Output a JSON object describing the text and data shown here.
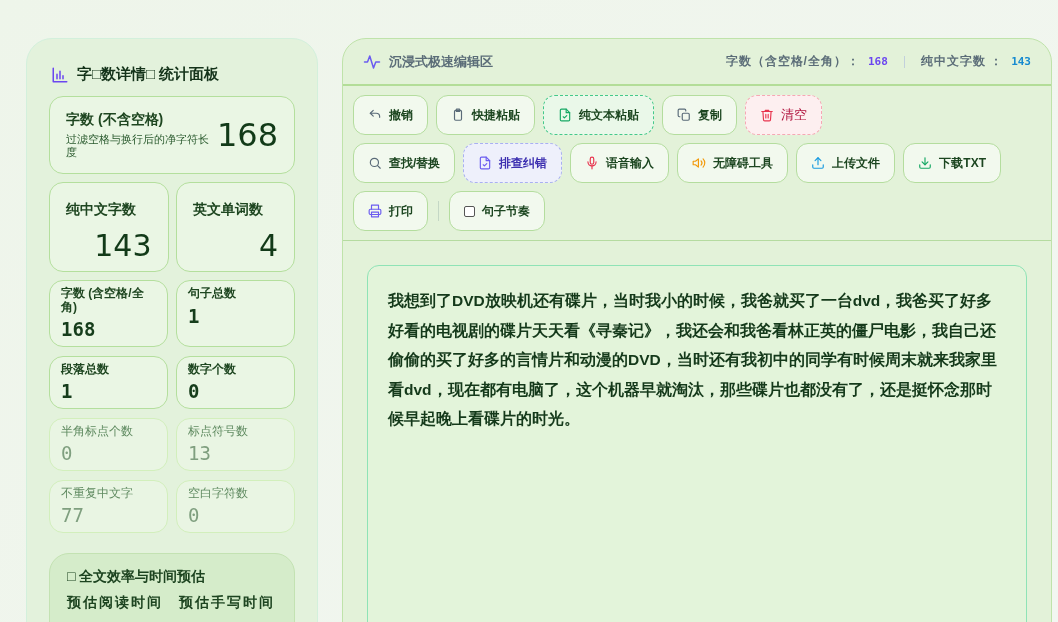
{
  "stats_panel": {
    "title": "字□数详情□ 统计面板",
    "primary": {
      "label": "字数 (不含空格)",
      "hint": "过滤空格与换行后的净字符长度",
      "value": "168"
    },
    "secondary": [
      {
        "label": "纯中文字数",
        "value": "143"
      },
      {
        "label": "英文单词数",
        "value": "4"
      }
    ],
    "cards": [
      {
        "label": "字数 (含空格/全角)",
        "value": "168",
        "muted": false
      },
      {
        "label": "句子总数",
        "value": "1",
        "muted": false
      },
      {
        "label": "段落总数",
        "value": "1",
        "muted": false
      },
      {
        "label": "数字个数",
        "value": "0",
        "muted": false
      },
      {
        "label": "半角标点个数",
        "value": "0",
        "muted": true
      },
      {
        "label": "标点符号数",
        "value": "13",
        "muted": true
      },
      {
        "label": "不重复中文字",
        "value": "77",
        "muted": true
      },
      {
        "label": "空白字符数",
        "value": "0",
        "muted": true
      }
    ],
    "estimate": {
      "title": "□ 全文效率与时间预估",
      "labels": [
        "预估阅读时间",
        "预估手写时间"
      ]
    }
  },
  "editor": {
    "title": "沉浸式极速编辑区",
    "header_stats": [
      {
        "label": "字数（含空格/全角）：",
        "value": "168",
        "kind": "purple"
      },
      {
        "label": "纯中文字数 ：",
        "value": "143",
        "kind": "blue"
      }
    ],
    "toolbar": [
      [
        {
          "label": "撤销",
          "kind": "plain"
        },
        {
          "label": "快捷粘贴",
          "kind": "plain"
        },
        {
          "label": "纯文本粘贴",
          "kind": "green"
        },
        {
          "label": "复制",
          "kind": "plain"
        },
        {
          "label": "清空",
          "kind": "red"
        }
      ],
      [
        {
          "label": "查找/替换",
          "kind": "plain"
        },
        {
          "label": "排查纠错",
          "kind": "purple"
        },
        {
          "label": "语音输入",
          "kind": "plain"
        },
        {
          "label": "无障碍工具",
          "kind": "plain"
        },
        {
          "label": "上传文件",
          "kind": "plain"
        },
        {
          "label": "下载TXT",
          "kind": "plain"
        }
      ],
      [
        {
          "label": "打印",
          "kind": "plain"
        },
        {
          "label": "句子节奏",
          "kind": "checkbox",
          "checked": false
        }
      ]
    ],
    "text": "我想到了DVD放映机还有碟片，当时我小的时候，我爸就买了一台dvd，我爸买了好多好看的电视剧的碟片天天看《寻秦记》，我还会和我爸看林正英的僵尸电影，我自己还偷偷的买了好多的言情片和动漫的DVD，当时还有我初中的同学有时候周末就来我家里看dvd，现在都有电脑了，这个机器早就淘汰，那些碟片也都没有了，还是挺怀念那时候早起晚上看碟片的时光。"
  }
}
